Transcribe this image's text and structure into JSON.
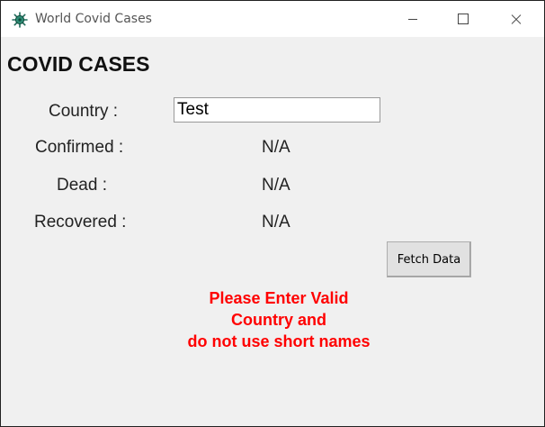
{
  "window": {
    "title": "World Covid Cases"
  },
  "main": {
    "heading": "COVID CASES",
    "country_label": "Country :",
    "country_value": "Test",
    "confirmed_label": "Confirmed :",
    "confirmed_value": "N/A",
    "dead_label": "Dead :",
    "dead_value": "N/A",
    "recovered_label": "Recovered :",
    "recovered_value": "N/A",
    "fetch_button": "Fetch Data",
    "error_line1": "Please Enter Valid",
    "error_line2": "Country and",
    "error_line3": "do not use short names"
  },
  "colors": {
    "error": "#ff0000",
    "window_bg": "#f0f0f0",
    "icon": "#1f6b5a"
  },
  "icons": {
    "app": "virus-icon"
  }
}
